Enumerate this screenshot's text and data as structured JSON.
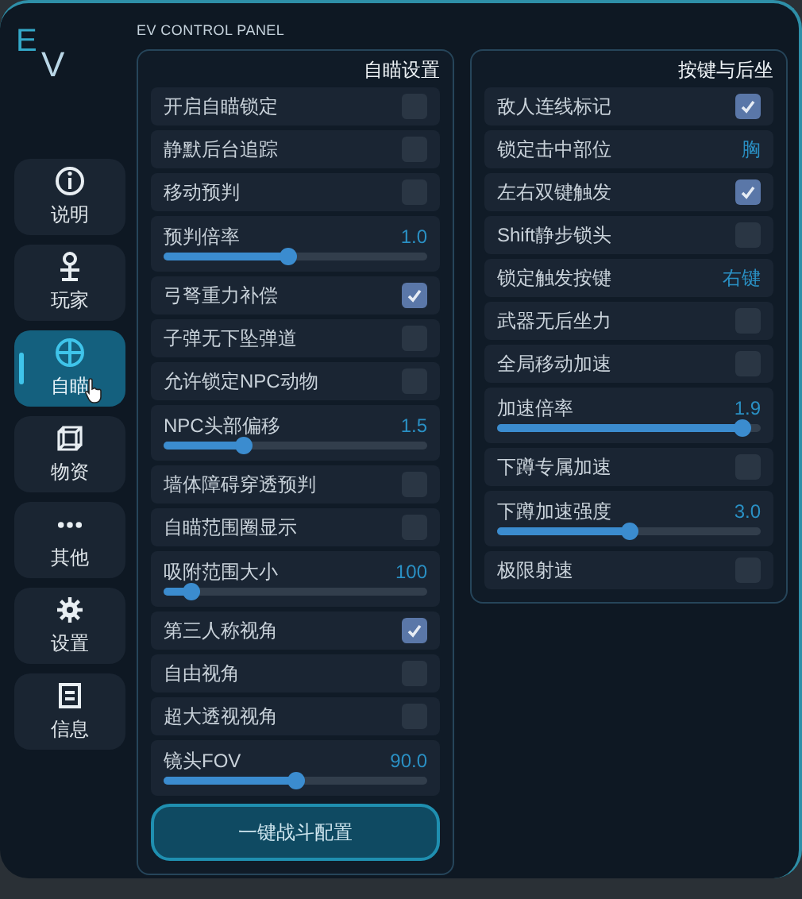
{
  "logo": {
    "top": "E",
    "bottom": "V"
  },
  "window": {
    "title": "EV CONTROL PANEL"
  },
  "sidebar": {
    "items": [
      {
        "label": "说明",
        "selected": false
      },
      {
        "label": "玩家",
        "selected": false
      },
      {
        "label": "自瞄",
        "selected": true
      },
      {
        "label": "物资",
        "selected": false
      },
      {
        "label": "其他",
        "selected": false
      },
      {
        "label": "设置",
        "selected": false
      },
      {
        "label": "信息",
        "selected": false
      }
    ]
  },
  "panels": [
    {
      "title": "自瞄设置",
      "rows": [
        {
          "kind": "toggle",
          "label": "开启自瞄锁定",
          "checked": false
        },
        {
          "kind": "toggle",
          "label": "静默后台追踪",
          "checked": false
        },
        {
          "kind": "toggle",
          "label": "移动预判",
          "checked": false
        },
        {
          "kind": "slider",
          "label": "预判倍率",
          "reading": "1.0",
          "level": 0.47
        },
        {
          "kind": "toggle",
          "label": "弓弩重力补偿",
          "checked": true
        },
        {
          "kind": "toggle",
          "label": "子弹无下坠弹道",
          "checked": false
        },
        {
          "kind": "toggle",
          "label": "允许锁定NPC动物",
          "checked": false
        },
        {
          "kind": "slider",
          "label": "NPC头部偏移",
          "reading": "1.5",
          "level": 0.3
        },
        {
          "kind": "toggle",
          "label": "墙体障碍穿透预判",
          "checked": false
        },
        {
          "kind": "toggle",
          "label": "自瞄范围圈显示",
          "checked": false
        },
        {
          "kind": "slider",
          "label": "吸附范围大小",
          "reading": "100",
          "level": 0.1
        },
        {
          "kind": "toggle",
          "label": "第三人称视角",
          "checked": true
        },
        {
          "kind": "toggle",
          "label": "自由视角",
          "checked": false
        },
        {
          "kind": "toggle",
          "label": "超大透视视角",
          "checked": false
        },
        {
          "kind": "slider",
          "label": "镜头FOV",
          "reading": "90.0",
          "level": 0.5
        }
      ],
      "button": "一键战斗配置"
    },
    {
      "title": "按键与后坐",
      "rows": [
        {
          "kind": "toggle",
          "label": "敌人连线标记",
          "checked": true
        },
        {
          "kind": "value",
          "label": "锁定击中部位",
          "value": "胸"
        },
        {
          "kind": "toggle",
          "label": "左右双键触发",
          "checked": true
        },
        {
          "kind": "toggle",
          "label": "Shift静步锁头",
          "checked": false
        },
        {
          "kind": "value",
          "label": "锁定触发按键",
          "value": "右键"
        },
        {
          "kind": "toggle",
          "label": "武器无后坐力",
          "checked": false
        },
        {
          "kind": "toggle",
          "label": "全局移动加速",
          "checked": false
        },
        {
          "kind": "slider",
          "label": "加速倍率",
          "reading": "1.9",
          "level": 0.93
        },
        {
          "kind": "toggle",
          "label": "下蹲专属加速",
          "checked": false
        },
        {
          "kind": "slider",
          "label": "下蹲加速强度",
          "reading": "3.0",
          "level": 0.5
        },
        {
          "kind": "toggle",
          "label": "极限射速",
          "checked": false
        }
      ]
    }
  ]
}
